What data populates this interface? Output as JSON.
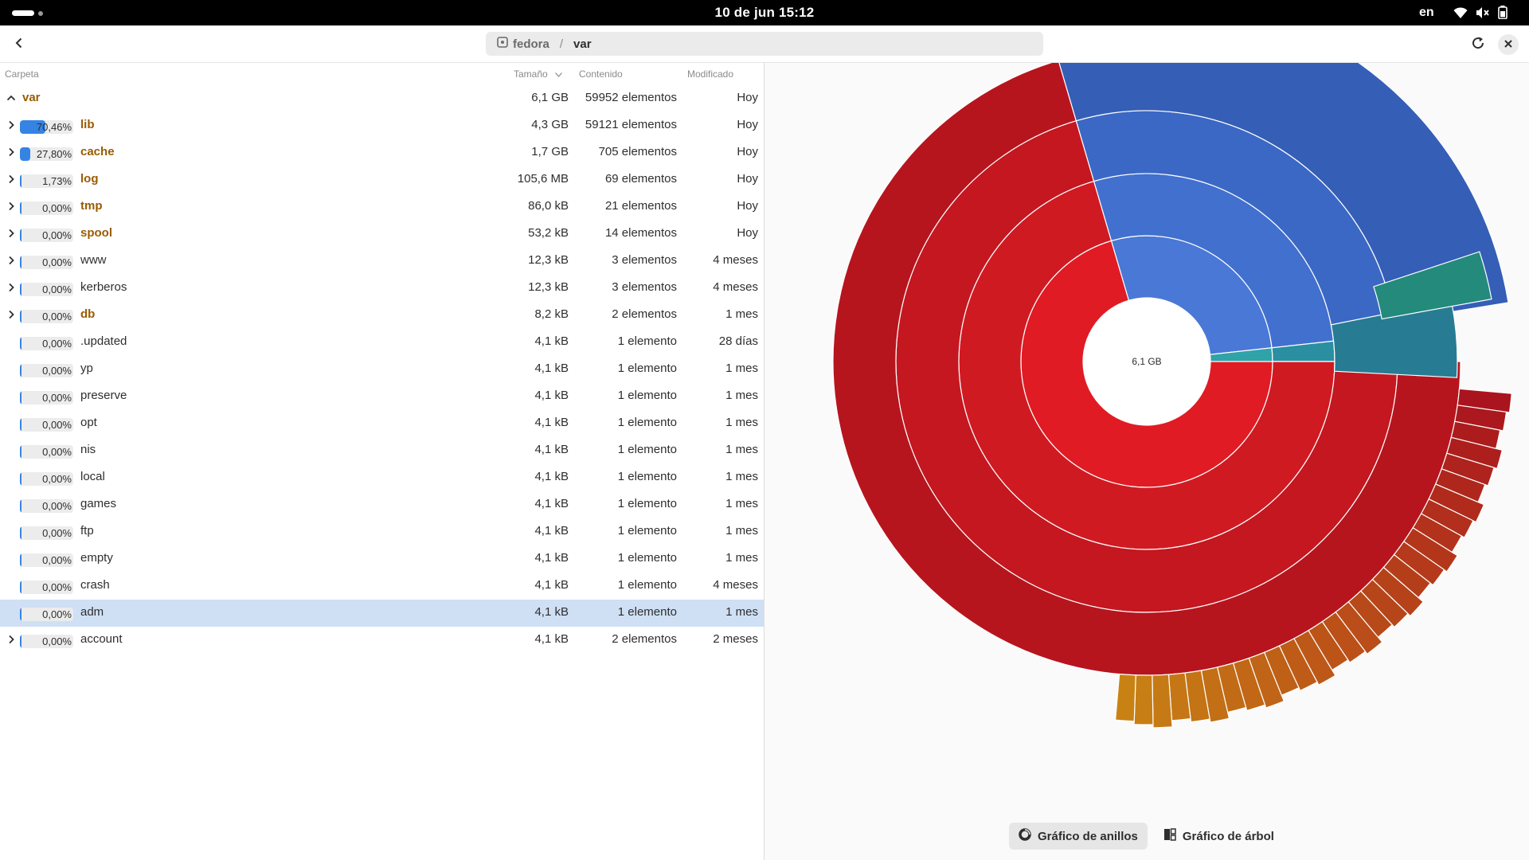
{
  "topbar": {
    "clock": "10 de jun  15:12",
    "language": "en",
    "icons": [
      "wifi-icon",
      "volume-muted-icon",
      "battery-icon"
    ]
  },
  "header": {
    "breadcrumb": {
      "root": "fedora",
      "separator": "/",
      "current": "var"
    },
    "icons": {
      "back": "chevron-left-icon",
      "reload": "reload-icon",
      "close": "close-icon",
      "root": "drive-icon"
    }
  },
  "columns": {
    "folder": "Carpeta",
    "size": "Tamaño",
    "content": "Contenido",
    "modified": "Modificado"
  },
  "root_row": {
    "name": "var",
    "size": "6,1 GB",
    "content": "59952 elementos",
    "modified": "Hoy"
  },
  "rows": [
    {
      "pct": "70,46%",
      "fraction": 0.7046,
      "name": "lib",
      "folder": true,
      "expander": true,
      "size": "4,3 GB",
      "content": "59121 elementos",
      "modified": "Hoy"
    },
    {
      "pct": "27,80%",
      "fraction": 0.278,
      "name": "cache",
      "folder": true,
      "expander": true,
      "size": "1,7 GB",
      "content": "705 elementos",
      "modified": "Hoy"
    },
    {
      "pct": "1,73%",
      "fraction": 0.0173,
      "name": "log",
      "folder": true,
      "expander": true,
      "size": "105,6 MB",
      "content": "69 elementos",
      "modified": "Hoy"
    },
    {
      "pct": "0,00%",
      "fraction": 0,
      "name": "tmp",
      "folder": true,
      "expander": true,
      "size": "86,0 kB",
      "content": "21 elementos",
      "modified": "Hoy"
    },
    {
      "pct": "0,00%",
      "fraction": 0,
      "name": "spool",
      "folder": true,
      "expander": true,
      "size": "53,2 kB",
      "content": "14 elementos",
      "modified": "Hoy"
    },
    {
      "pct": "0,00%",
      "fraction": 0,
      "name": "www",
      "folder": false,
      "expander": true,
      "size": "12,3 kB",
      "content": "3 elementos",
      "modified": "4 meses"
    },
    {
      "pct": "0,00%",
      "fraction": 0,
      "name": "kerberos",
      "folder": false,
      "expander": true,
      "size": "12,3 kB",
      "content": "3 elementos",
      "modified": "4 meses"
    },
    {
      "pct": "0,00%",
      "fraction": 0,
      "name": "db",
      "folder": true,
      "expander": true,
      "size": "8,2 kB",
      "content": "2 elementos",
      "modified": "1 mes"
    },
    {
      "pct": "0,00%",
      "fraction": 0,
      "name": ".updated",
      "folder": false,
      "expander": false,
      "size": "4,1 kB",
      "content": "1 elemento",
      "modified": "28 días"
    },
    {
      "pct": "0,00%",
      "fraction": 0,
      "name": "yp",
      "folder": false,
      "expander": false,
      "size": "4,1 kB",
      "content": "1 elemento",
      "modified": "1 mes"
    },
    {
      "pct": "0,00%",
      "fraction": 0,
      "name": "preserve",
      "folder": false,
      "expander": false,
      "size": "4,1 kB",
      "content": "1 elemento",
      "modified": "1 mes"
    },
    {
      "pct": "0,00%",
      "fraction": 0,
      "name": "opt",
      "folder": false,
      "expander": false,
      "size": "4,1 kB",
      "content": "1 elemento",
      "modified": "1 mes"
    },
    {
      "pct": "0,00%",
      "fraction": 0,
      "name": "nis",
      "folder": false,
      "expander": false,
      "size": "4,1 kB",
      "content": "1 elemento",
      "modified": "1 mes"
    },
    {
      "pct": "0,00%",
      "fraction": 0,
      "name": "local",
      "folder": false,
      "expander": false,
      "size": "4,1 kB",
      "content": "1 elemento",
      "modified": "1 mes"
    },
    {
      "pct": "0,00%",
      "fraction": 0,
      "name": "games",
      "folder": false,
      "expander": false,
      "size": "4,1 kB",
      "content": "1 elemento",
      "modified": "1 mes"
    },
    {
      "pct": "0,00%",
      "fraction": 0,
      "name": "ftp",
      "folder": false,
      "expander": false,
      "size": "4,1 kB",
      "content": "1 elemento",
      "modified": "1 mes"
    },
    {
      "pct": "0,00%",
      "fraction": 0,
      "name": "empty",
      "folder": false,
      "expander": false,
      "size": "4,1 kB",
      "content": "1 elemento",
      "modified": "1 mes"
    },
    {
      "pct": "0,00%",
      "fraction": 0,
      "name": "crash",
      "folder": false,
      "expander": false,
      "size": "4,1 kB",
      "content": "1 elemento",
      "modified": "4 meses"
    },
    {
      "pct": "0,00%",
      "fraction": 0,
      "name": "adm",
      "folder": false,
      "expander": false,
      "selected": true,
      "size": "4,1 kB",
      "content": "1 elemento",
      "modified": "1 mes"
    },
    {
      "pct": "0,00%",
      "fraction": 0,
      "name": "account",
      "folder": false,
      "expander": true,
      "size": "4,1 kB",
      "content": "2 elementos",
      "modified": "2 meses"
    }
  ],
  "ring_chart": {
    "center_label": "6,1 GB",
    "colors": {
      "lib": "#e01b24",
      "cache": "#3c6fcf",
      "log": "#2a8fa0",
      "other_small": "#c01c28",
      "tail": "#c87a10"
    },
    "top_level": [
      {
        "name": "lib",
        "fraction": 0.7046
      },
      {
        "name": "cache",
        "fraction": 0.278
      },
      {
        "name": "log",
        "fraction": 0.0173
      }
    ]
  },
  "view_switcher": {
    "ring_label": "Gráfico de anillos",
    "tree_label": "Gráfico de árbol",
    "active": "ring",
    "icons": {
      "ring": "ring-chart-icon",
      "tree": "tree-chart-icon"
    }
  }
}
